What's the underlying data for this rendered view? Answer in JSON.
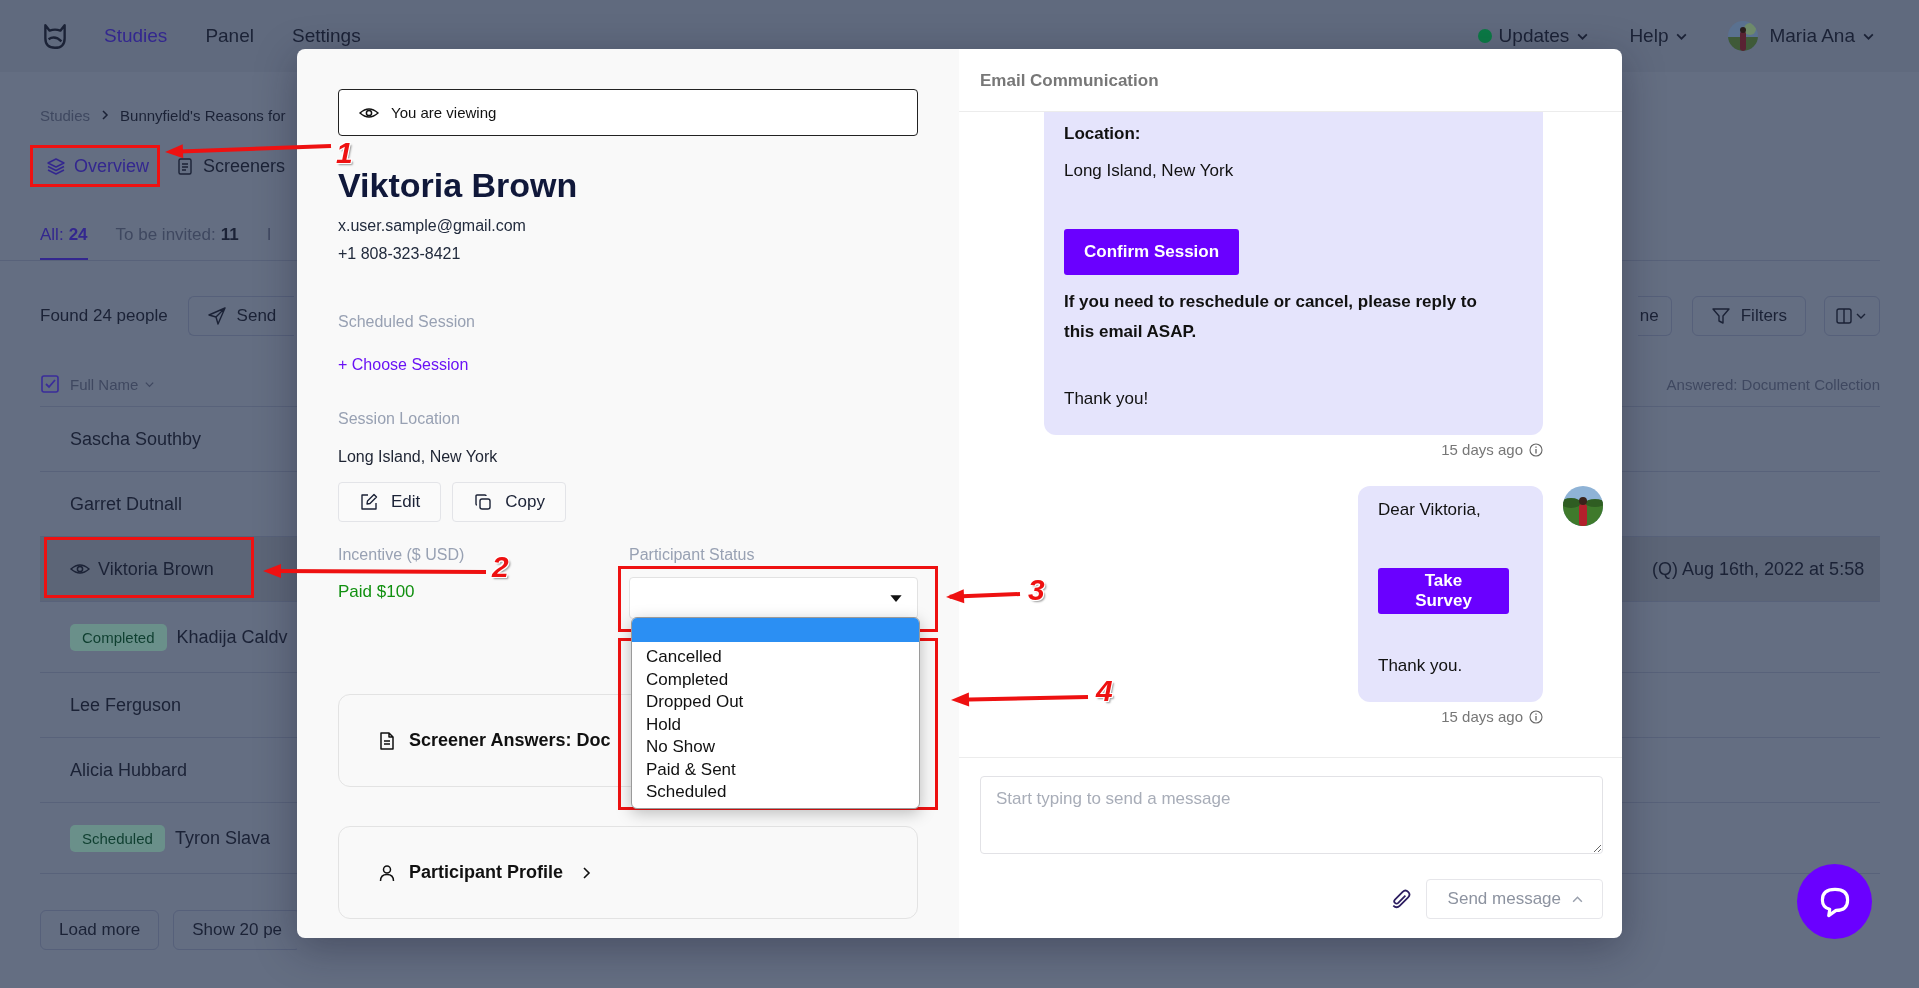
{
  "nav": {
    "items": [
      {
        "label": "Studies",
        "selected": true
      },
      {
        "label": "Panel",
        "selected": false
      },
      {
        "label": "Settings",
        "selected": false
      }
    ],
    "menus": [
      {
        "label": "Updates",
        "color": "#0b7a45"
      },
      {
        "label": "Help"
      }
    ],
    "user": "Maria Ana"
  },
  "breadcrumb": [
    "Studies",
    "Bunnyfield's Reasons for"
  ],
  "view_tabs": [
    {
      "label": "Overview",
      "selected": true
    },
    {
      "label": "Screeners",
      "selected": false
    }
  ],
  "counts": [
    {
      "label": "All:",
      "value": "24",
      "selected": true
    },
    {
      "label": "To be invited:",
      "value": "11",
      "selected": false
    },
    {
      "label": "I",
      "selected": false
    }
  ],
  "toolbar": {
    "found": "Found 24 people",
    "send": "Send",
    "cut_button": "ne",
    "filters": "Filters"
  },
  "table": {
    "column_1": "Full Name",
    "all_checked": true,
    "column_2": "Answered: Document Collection",
    "rows": [
      {
        "name": "Sascha Southby",
        "selected": false
      },
      {
        "name": "Garret Dutnall",
        "selected": false
      },
      {
        "name": "Viktoria Brown",
        "selected": true,
        "answered": "(Q) Aug 16th, 2022 at 5:58"
      },
      {
        "name": "Khadija Caldv",
        "selected": false,
        "badge": "Completed"
      },
      {
        "name": "Lee Ferguson",
        "selected": false
      },
      {
        "name": "Alicia Hubbard",
        "selected": false
      },
      {
        "name": "Tyron Slava",
        "selected": false,
        "badge": "Scheduled"
      }
    ]
  },
  "footer": {
    "load_more": "Load more",
    "per_page": "Show 20 pe"
  },
  "participant": {
    "viewing_notice": "You are viewing",
    "name": "Viktoria Brown",
    "email": "x.user.sample@gmail.com",
    "phone": "+1 808-323-8421",
    "scheduled_label": "Scheduled Session",
    "choose_session": "+ Choose Session",
    "location_label": "Session Location",
    "location": "Long Island, New York",
    "buttons": [
      {
        "kind": "edit",
        "label": "Edit"
      },
      {
        "kind": "copy",
        "label": "Copy"
      }
    ],
    "incentive_label": "Incentive ($ USD)",
    "incentive": "Paid $100",
    "status_label": "Participant Status",
    "status_dropdown": {
      "blank_highlighted": true,
      "options": [
        {
          "label": "Cancelled",
          "selected": false
        },
        {
          "label": "Completed",
          "selected": false
        },
        {
          "label": "Dropped Out",
          "selected": false
        },
        {
          "label": "Hold",
          "selected": false
        },
        {
          "label": "No Show",
          "selected": false
        },
        {
          "label": "Paid & Sent",
          "selected": false
        },
        {
          "label": "Scheduled",
          "selected": false
        }
      ]
    },
    "cards": [
      {
        "kind": "document",
        "label": "Screener Answers: Doc"
      },
      {
        "kind": "profile",
        "label": "Participant Profile"
      }
    ]
  },
  "email": {
    "title": "Email Communication",
    "messages": [
      {
        "kind": "received",
        "time": "15 days ago",
        "parts": [
          {
            "kind": "label",
            "text": "Location:"
          },
          {
            "kind": "text",
            "text": "Long Island, New York"
          },
          {
            "kind": "button",
            "text": "Confirm Session"
          },
          {
            "kind": "note",
            "text": "If you need to reschedule or cancel, please reply to this email ASAP."
          },
          {
            "kind": "text",
            "text": "Thank you!"
          }
        ]
      },
      {
        "kind": "sent",
        "time": "15 days ago",
        "parts": [
          {
            "kind": "text",
            "text": "Dear Viktoria,"
          },
          {
            "kind": "button",
            "text": "Take Survey"
          },
          {
            "kind": "text",
            "text": "Thank you."
          }
        ]
      }
    ],
    "placeholder": "Start typing to send a message",
    "send": "Send message"
  },
  "annotations": [
    {
      "number": "1"
    },
    {
      "number": "2"
    },
    {
      "number": "3"
    },
    {
      "number": "4"
    }
  ]
}
